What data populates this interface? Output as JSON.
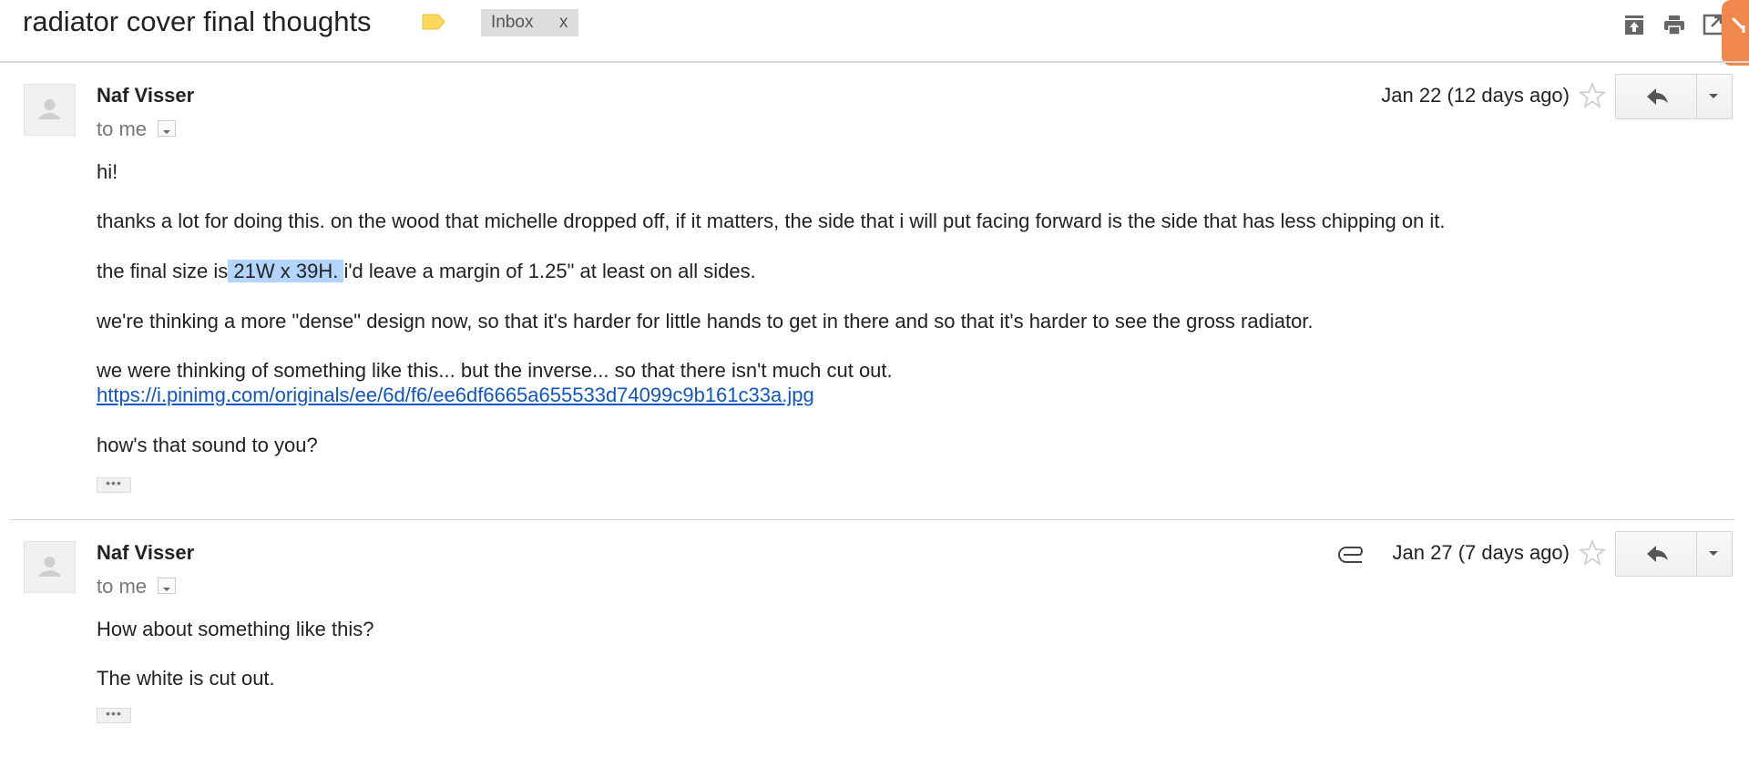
{
  "thread": {
    "subject": "radiator cover final thoughts",
    "labels": [
      {
        "name": "Inbox",
        "remove": "x"
      }
    ],
    "label_color": "#fbd75b",
    "toolbar_icons": [
      "archive-up-icon",
      "printer-icon",
      "new-window-icon"
    ]
  },
  "messages": [
    {
      "sender": "Naf Visser",
      "recipient": "to me",
      "date": "Jan 22 (12 days ago)",
      "body": {
        "p1": "hi!",
        "p2": "thanks a lot for doing this. on the wood that michelle dropped off, if it matters, the side that i will put facing forward is the side that has less chipping on it.",
        "p3_before": "the final size is",
        "p3_highlight": " 21W x 39H. ",
        "p3_after": " i'd leave a margin of 1.25\" at least on all sides.",
        "p4": "we're thinking a more \"dense\" design now, so that it's harder for little hands to get in there and so that it's harder to see the gross radiator.",
        "p5": "we were thinking of something like this... but the inverse... so that there isn't much cut out.",
        "link": "https://i.pinimg.com/originals/ee/6d/f6/ee6df6665a655533d74099c9b161c33a.jpg",
        "p6": "how's that sound to you?"
      },
      "trimmed": "•••",
      "has_attachment": false
    },
    {
      "sender": "Naf Visser",
      "recipient": "to me",
      "date": "Jan 27 (7 days ago)",
      "body": {
        "p1": "How about something like this?",
        "p2": "The white is cut out."
      },
      "trimmed": "•••",
      "has_attachment": true
    }
  ],
  "colors": {
    "link": "#1155cc",
    "selection": "#b3d4fc",
    "accent_tab": "#f0874d"
  }
}
